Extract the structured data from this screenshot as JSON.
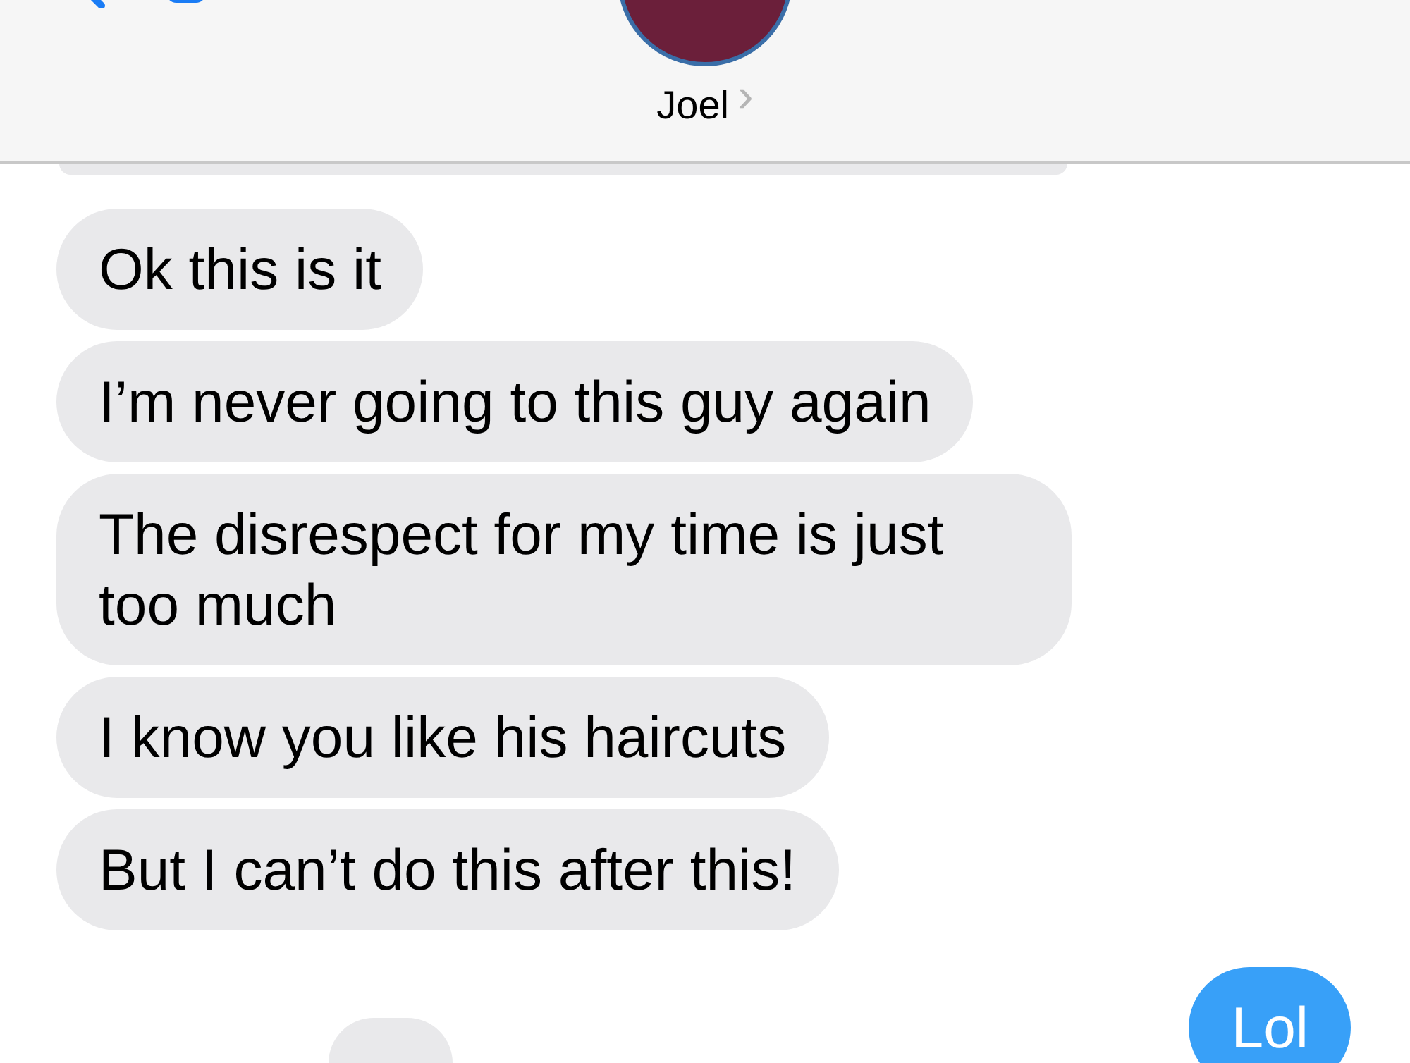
{
  "header": {
    "contact_name": "Joel",
    "chevron": "›"
  },
  "messages": [
    {
      "kind": "received",
      "text": "Ok this is it"
    },
    {
      "kind": "received",
      "text": "I’m never going to this guy again"
    },
    {
      "kind": "received",
      "text": "The disrespect for my time is just too much"
    },
    {
      "kind": "received",
      "text": "I know you like his haircuts"
    },
    {
      "kind": "received",
      "text": "But I can’t do this after this!"
    },
    {
      "kind": "sent",
      "text": "Lol"
    }
  ]
}
